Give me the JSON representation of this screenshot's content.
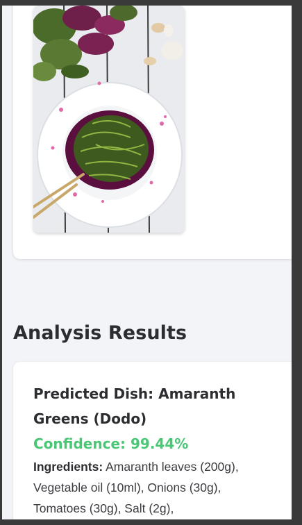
{
  "results": {
    "section_title": "Analysis Results",
    "predicted_label": "Predicted Dish:",
    "predicted_value": "Amaranth Greens (Dodo)",
    "confidence_label": "Confidence:",
    "confidence_value": "99.44%",
    "ingredients_label": "Ingredients:",
    "ingredients_text": "Amaranth leaves (200g), Vegetable oil (10ml), Onions (30g), Tomatoes (30g), Salt (2g),"
  },
  "colors": {
    "confidence": "#48c774",
    "heading": "#2b2d31",
    "page_background": "#f3f4f7",
    "card_background": "#ffffff"
  },
  "image": {
    "description_icon": "food-photo-icon"
  }
}
